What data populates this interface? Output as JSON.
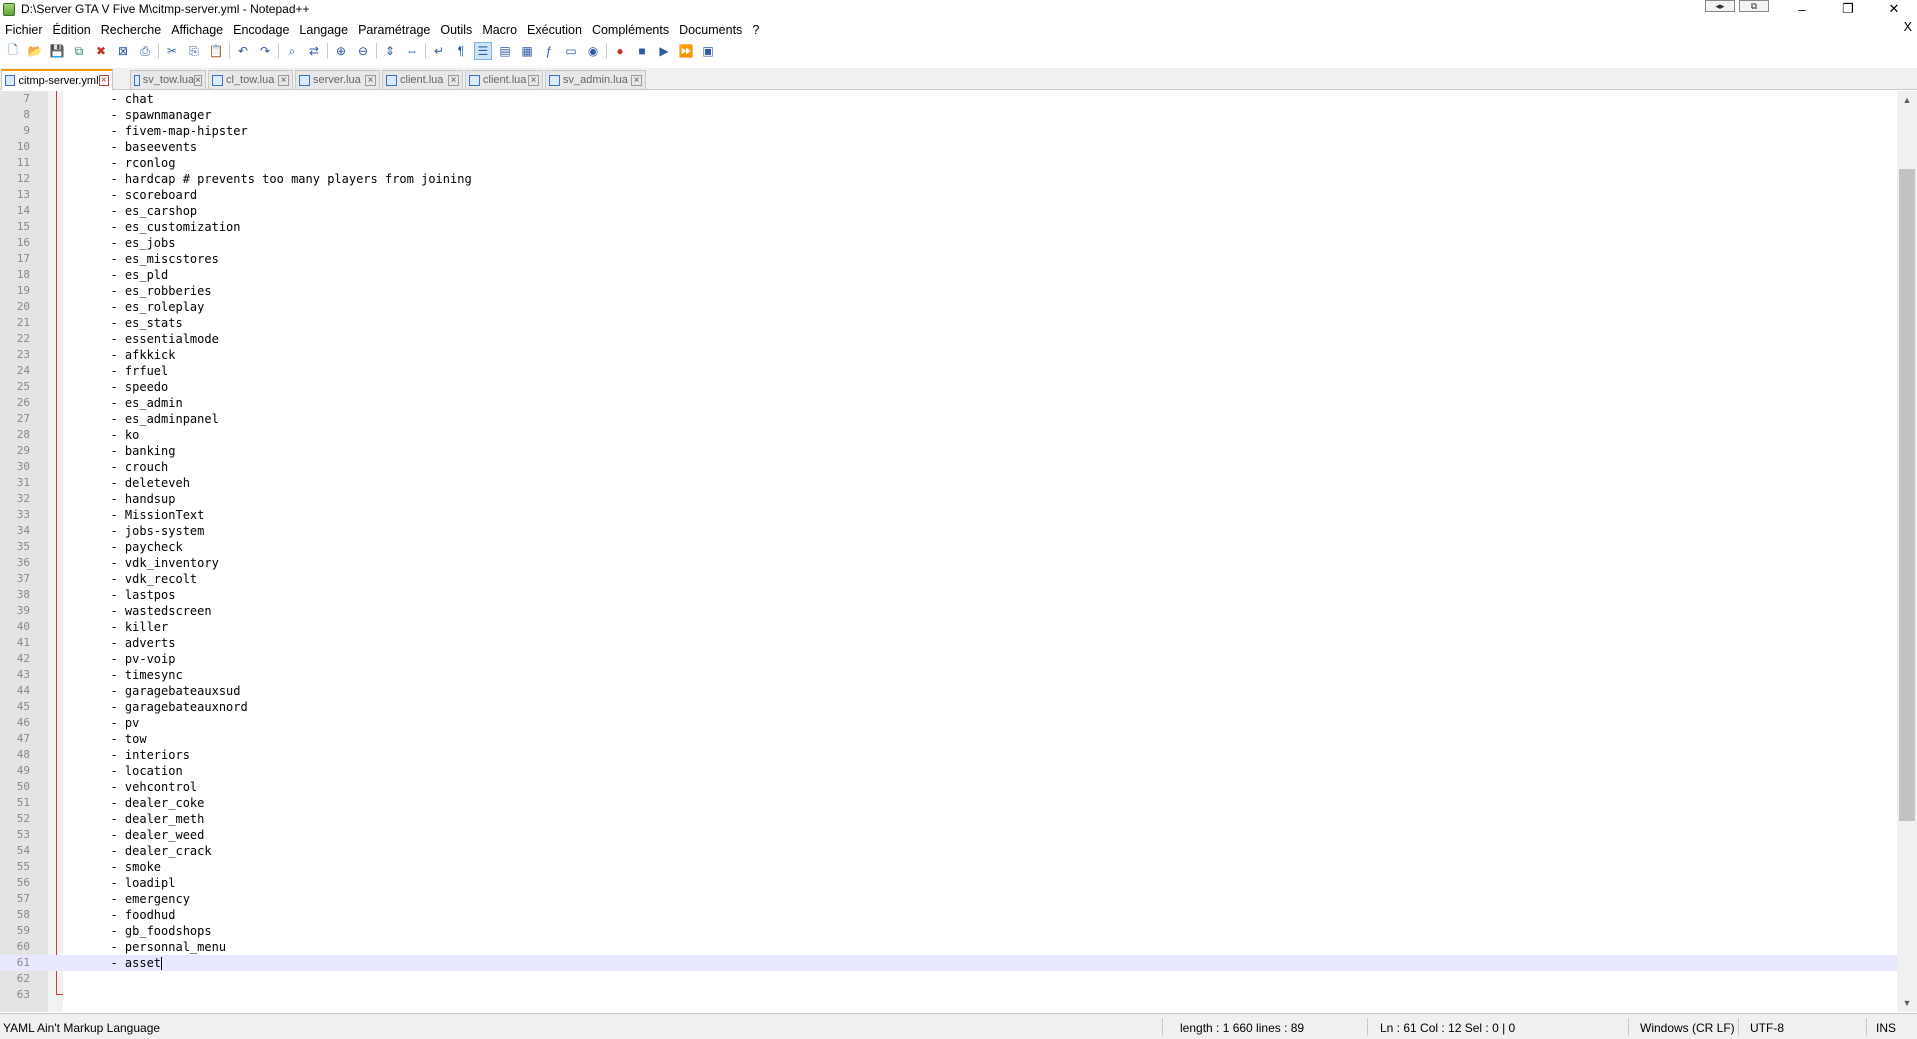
{
  "window": {
    "title": "D:\\Server GTA V Five M\\citmp-server.yml - Notepad++",
    "minimize": "–",
    "maximize": "❐",
    "close": "✕",
    "extra_btn_1": "◂▸",
    "extra_btn_2": "⧉"
  },
  "menu": {
    "items": [
      "Fichier",
      "Édition",
      "Recherche",
      "Affichage",
      "Encodage",
      "Langage",
      "Paramétrage",
      "Outils",
      "Macro",
      "Exécution",
      "Compléments",
      "Documents",
      "?"
    ],
    "close_label": "X"
  },
  "toolbar": {
    "icons": [
      "new-file-icon",
      "open-file-icon",
      "save-icon",
      "save-all-icon",
      "close-icon",
      "close-all-icon",
      "print-icon",
      "cut-icon",
      "copy-icon",
      "paste-icon",
      "undo-icon",
      "redo-icon",
      "find-icon",
      "replace-icon",
      "zoom-in-icon",
      "zoom-out-icon",
      "sync-vertical-icon",
      "sync-horizontal-icon",
      "word-wrap-icon",
      "show-all-chars-icon",
      "indent-guide-icon",
      "user-language-icon",
      "doc-map-icon",
      "function-list-icon",
      "folder-workspace-icon",
      "monitoring-icon",
      "record-macro-icon",
      "stop-macro-icon",
      "play-macro-icon",
      "run-macro-multiple-icon",
      "save-macro-icon"
    ]
  },
  "tabs": [
    {
      "label": "citmp-server.yml",
      "active": true
    },
    {
      "label": "sv_tow.lua",
      "active": false
    },
    {
      "label": "cl_tow.lua",
      "active": false
    },
    {
      "label": "server.lua",
      "active": false
    },
    {
      "label": "client.lua",
      "active": false
    },
    {
      "label": "client.lua",
      "active": false
    },
    {
      "label": "sv_admin.lua",
      "active": false
    }
  ],
  "editor": {
    "current_line": 61,
    "lines": [
      {
        "n": "7",
        "text": "  - chat"
      },
      {
        "n": "8",
        "text": "  - spawnmanager"
      },
      {
        "n": "9",
        "text": "  - fivem-map-hipster"
      },
      {
        "n": "10",
        "text": "  - baseevents"
      },
      {
        "n": "11",
        "text": "  - rconlog"
      },
      {
        "n": "12",
        "text": "  - hardcap # prevents too many players from joining"
      },
      {
        "n": "13",
        "text": "  - scoreboard"
      },
      {
        "n": "14",
        "text": "  - es_carshop"
      },
      {
        "n": "15",
        "text": "  - es_customization"
      },
      {
        "n": "16",
        "text": "  - es_jobs"
      },
      {
        "n": "17",
        "text": "  - es_miscstores"
      },
      {
        "n": "18",
        "text": "  - es_pld"
      },
      {
        "n": "19",
        "text": "  - es_robberies"
      },
      {
        "n": "20",
        "text": "  - es_roleplay"
      },
      {
        "n": "21",
        "text": "  - es_stats"
      },
      {
        "n": "22",
        "text": "  - essentialmode"
      },
      {
        "n": "23",
        "text": "  - afkkick"
      },
      {
        "n": "24",
        "text": "  - frfuel"
      },
      {
        "n": "25",
        "text": "  - speedo"
      },
      {
        "n": "26",
        "text": "  - es_admin"
      },
      {
        "n": "27",
        "text": "  - es_adminpanel"
      },
      {
        "n": "28",
        "text": "  - ko"
      },
      {
        "n": "29",
        "text": "  - banking"
      },
      {
        "n": "30",
        "text": "  - crouch"
      },
      {
        "n": "31",
        "text": "  - deleteveh"
      },
      {
        "n": "32",
        "text": "  - handsup"
      },
      {
        "n": "33",
        "text": "  - MissionText"
      },
      {
        "n": "34",
        "text": "  - jobs-system"
      },
      {
        "n": "35",
        "text": "  - paycheck"
      },
      {
        "n": "36",
        "text": "  - vdk_inventory"
      },
      {
        "n": "37",
        "text": "  - vdk_recolt"
      },
      {
        "n": "38",
        "text": "  - lastpos"
      },
      {
        "n": "39",
        "text": "  - wastedscreen"
      },
      {
        "n": "40",
        "text": "  - killer"
      },
      {
        "n": "41",
        "text": "  - adverts"
      },
      {
        "n": "42",
        "text": "  - pv-voip"
      },
      {
        "n": "43",
        "text": "  - timesync"
      },
      {
        "n": "44",
        "text": "  - garagebateauxsud"
      },
      {
        "n": "45",
        "text": "  - garagebateauxnord"
      },
      {
        "n": "46",
        "text": "  - pv"
      },
      {
        "n": "47",
        "text": "  - tow"
      },
      {
        "n": "48",
        "text": "  - interiors"
      },
      {
        "n": "49",
        "text": "  - location"
      },
      {
        "n": "50",
        "text": "  - vehcontrol"
      },
      {
        "n": "51",
        "text": "  - dealer_coke"
      },
      {
        "n": "52",
        "text": "  - dealer_meth"
      },
      {
        "n": "53",
        "text": "  - dealer_weed"
      },
      {
        "n": "54",
        "text": "  - dealer_crack"
      },
      {
        "n": "55",
        "text": "  - smoke"
      },
      {
        "n": "56",
        "text": "  - loadipl"
      },
      {
        "n": "57",
        "text": "  - emergency"
      },
      {
        "n": "58",
        "text": "  - foodhud"
      },
      {
        "n": "59",
        "text": "  - gb_foodshops"
      },
      {
        "n": "60",
        "text": "  - personnal_menu"
      },
      {
        "n": "61",
        "text": "  - asset"
      },
      {
        "n": "62",
        "text": ""
      },
      {
        "n": "63",
        "text": ""
      }
    ]
  },
  "statusbar": {
    "language": "YAML Ain't Markup Language",
    "length_lines": "length : 1 660    lines : 89",
    "position": "Ln : 61    Col : 12    Sel : 0 | 0",
    "eol": "Windows (CR LF)",
    "encoding": "UTF-8",
    "mode": "INS"
  },
  "colors": {
    "active_tab_accent": "#f39c12",
    "fold_marker": "#d23b3b",
    "current_line_bg": "#e8e8ff"
  }
}
